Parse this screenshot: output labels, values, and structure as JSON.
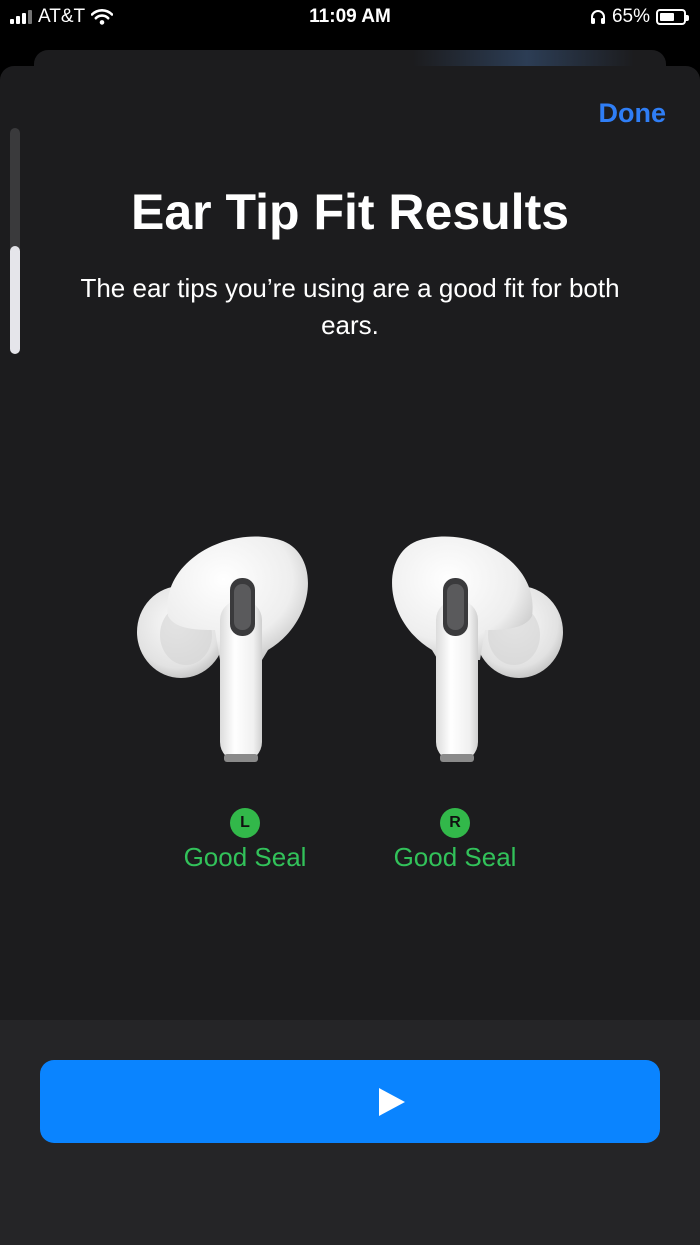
{
  "status_bar": {
    "carrier": "AT&T",
    "time": "11:09 AM",
    "battery_percent": "65%",
    "battery_level": 0.65,
    "icons": [
      "signal-icon",
      "wifi-icon",
      "headphones-icon",
      "battery-icon"
    ]
  },
  "sheet": {
    "done_label": "Done",
    "title": "Ear Tip Fit Results",
    "subtitle": "The ear tips you’re using are a good fit for both ears.",
    "scroll_position": 0.48
  },
  "results": {
    "left": {
      "badge": "L",
      "status": "Good Seal"
    },
    "right": {
      "badge": "R",
      "status": "Good Seal"
    }
  },
  "colors": {
    "accent": "#0a84ff",
    "good": "#32c25a",
    "sheet_bg": "#1c1c1e"
  },
  "actions": {
    "play_icon": "play-icon"
  }
}
